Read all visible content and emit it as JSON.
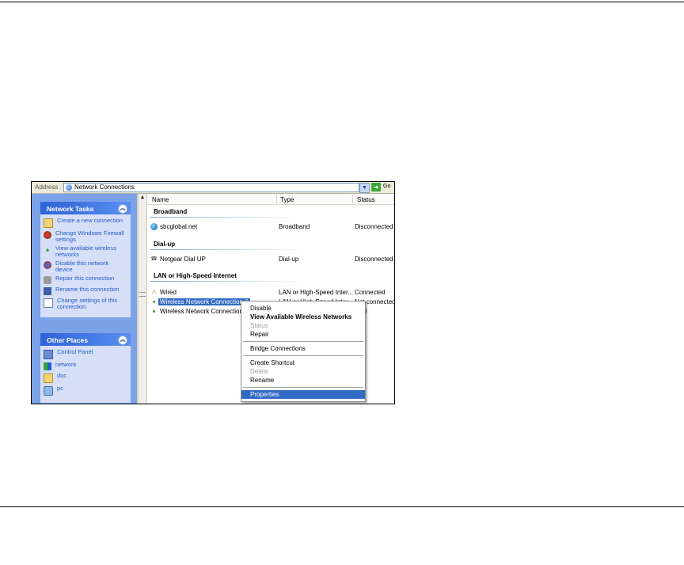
{
  "address_bar": {
    "label": "Address",
    "value": "Network Connections",
    "go_label": "Go"
  },
  "network_tasks": {
    "title": "Network Tasks",
    "items": [
      {
        "label": "Create a new connection",
        "icon": "new-connection-icon"
      },
      {
        "label": "Change Windows Firewall settings",
        "icon": "firewall-icon"
      },
      {
        "label": "View available wireless networks",
        "icon": "wireless-icon"
      },
      {
        "label": "Disable this network device",
        "icon": "disable-device-icon"
      },
      {
        "label": "Repair this connection",
        "icon": "repair-icon"
      },
      {
        "label": "Rename this connection",
        "icon": "rename-icon"
      },
      {
        "label": "Change settings of this connection",
        "icon": "settings-icon"
      }
    ]
  },
  "other_places": {
    "title": "Other Places",
    "items": [
      {
        "label": "Control Panel",
        "icon": "control-panel-icon"
      },
      {
        "label": "network",
        "icon": "network-places-icon"
      },
      {
        "label": "doc",
        "icon": "folder-icon"
      },
      {
        "label": "pc",
        "icon": "computer-icon"
      }
    ]
  },
  "columns": {
    "name": "Name",
    "type": "Type",
    "status": "Status"
  },
  "groups": {
    "broadband": "Broadband",
    "dialup": "Dial-up",
    "lan": "LAN or High-Speed Internet"
  },
  "connections": [
    {
      "name": "sbcglobal.net",
      "type": "Broadband",
      "status": "Disconnected",
      "icon": "globe-icon"
    },
    {
      "name": "Netgear Dial UP",
      "type": "Dial-up",
      "status": "Disconnected",
      "icon": "dialup-icon"
    },
    {
      "name": "Wired",
      "type": "LAN or High-Speed Inter...",
      "status": "Connected",
      "icon": "wired-icon"
    },
    {
      "name": "Wireless Network Connection 6",
      "type": "LAN or High-Speed Inter...",
      "status": "Not connected",
      "icon": "wireless-icon"
    },
    {
      "name": "Wireless Network Connection",
      "type": "",
      "status": "bled",
      "icon": "wireless-icon"
    }
  ],
  "context_menu": {
    "items": [
      {
        "label": "Disable"
      },
      {
        "label": "View Available Wireless Networks"
      },
      {
        "label": "Status"
      },
      {
        "label": "Repair"
      },
      {
        "label": "Bridge Connections"
      },
      {
        "label": "Create Shortcut"
      },
      {
        "label": "Delete"
      },
      {
        "label": "Rename"
      },
      {
        "label": "Properties"
      }
    ]
  },
  "colors": {
    "task_pane_bg": "#7ba2e7",
    "panel_header": "#2d63d6",
    "link": "#215dc6",
    "selection": "#316ac5"
  }
}
